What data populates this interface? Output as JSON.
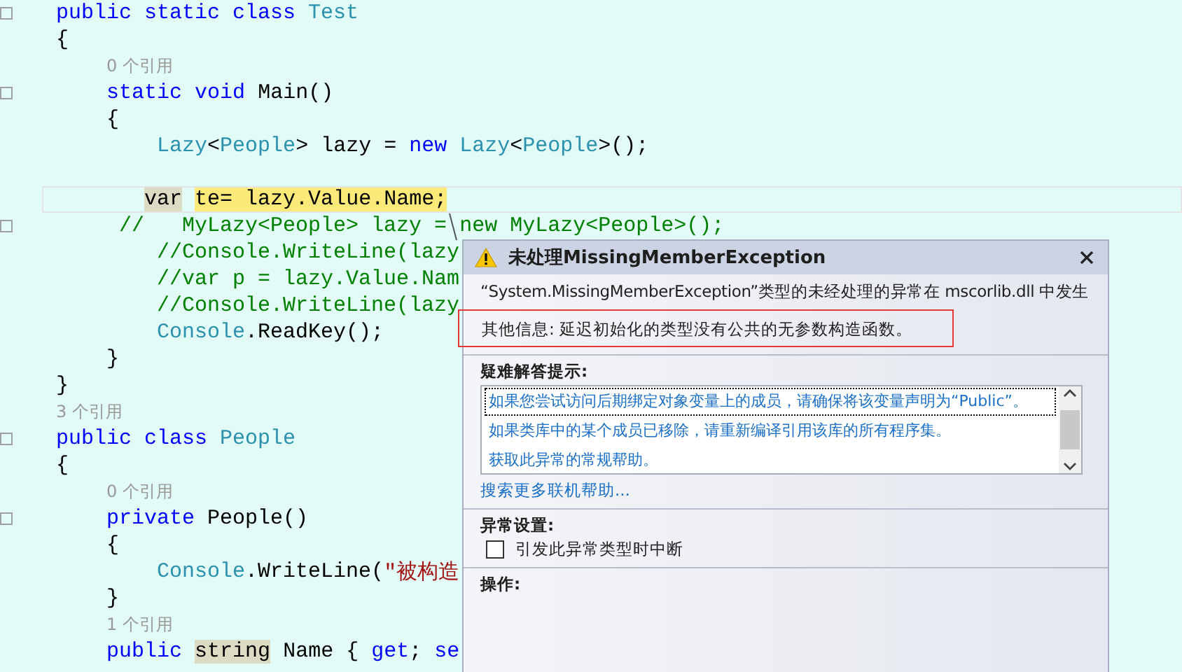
{
  "editor": {
    "lines": [
      {
        "collapsible": true,
        "current": false,
        "tokens": [
          {
            "kind": "keyword",
            "text": "public static class"
          },
          {
            "kind": "type",
            "text": " Test"
          }
        ]
      },
      {
        "collapsible": false,
        "current": false,
        "tokens": [
          {
            "kind": "plain",
            "text": "{"
          }
        ]
      },
      {
        "collapsible": false,
        "current": false,
        "tokens": [
          {
            "kind": "codelens",
            "text": "    0 个引用"
          }
        ]
      },
      {
        "collapsible": true,
        "current": false,
        "tokens": [
          {
            "kind": "keyword",
            "text": "    static void"
          },
          {
            "kind": "plain",
            "text": " Main()"
          }
        ]
      },
      {
        "collapsible": false,
        "current": false,
        "tokens": [
          {
            "kind": "plain",
            "text": "    {"
          }
        ]
      },
      {
        "collapsible": false,
        "current": false,
        "tokens": [
          {
            "kind": "type",
            "text": "        Lazy"
          },
          {
            "kind": "plain",
            "text": "<"
          },
          {
            "kind": "type",
            "text": "People"
          },
          {
            "kind": "plain",
            "text": "> lazy = "
          },
          {
            "kind": "keyword",
            "text": "new"
          },
          {
            "kind": "type",
            "text": " Lazy"
          },
          {
            "kind": "plain",
            "text": "<"
          },
          {
            "kind": "type",
            "text": "People"
          },
          {
            "kind": "plain",
            "text": ">();"
          }
        ]
      },
      {
        "collapsible": false,
        "current": false
      },
      {
        "collapsible": false,
        "current": true,
        "tokens": [
          {
            "kind": "highlight_dim",
            "text": "       var"
          },
          {
            "kind": "highlight",
            "text": " te= lazy.Value.Name;"
          }
        ]
      },
      {
        "collapsible": true,
        "current": false,
        "tokens": [
          {
            "kind": "comment",
            "text": "     //   MyLazy<People> lazy ="
          },
          {
            "kind": "comment",
            "text": " new MyLazy<People>();"
          }
        ]
      },
      {
        "collapsible": false,
        "current": false,
        "tokens": [
          {
            "kind": "comment",
            "text": "        //Console.WriteLine(lazy"
          }
        ]
      },
      {
        "collapsible": false,
        "current": false,
        "tokens": [
          {
            "kind": "comment",
            "text": "        //var p = lazy.Value.Nam"
          }
        ]
      },
      {
        "collapsible": false,
        "current": false,
        "tokens": [
          {
            "kind": "comment",
            "text": "        //Console.WriteLine(lazy"
          }
        ]
      },
      {
        "collapsible": false,
        "current": false,
        "tokens": [
          {
            "kind": "type",
            "text": "        Console"
          },
          {
            "kind": "plain",
            "text": ".ReadKey();"
          }
        ]
      },
      {
        "collapsible": false,
        "current": false,
        "tokens": [
          {
            "kind": "plain",
            "text": "    }"
          }
        ]
      },
      {
        "collapsible": false,
        "current": false,
        "tokens": [
          {
            "kind": "plain",
            "text": "}"
          }
        ]
      },
      {
        "collapsible": false,
        "current": false,
        "tokens": [
          {
            "kind": "codelens",
            "text": "3 个引用"
          }
        ]
      },
      {
        "collapsible": true,
        "current": false,
        "tokens": [
          {
            "kind": "keyword",
            "text": "public class"
          },
          {
            "kind": "type",
            "text": " People"
          }
        ]
      },
      {
        "collapsible": false,
        "current": false,
        "tokens": [
          {
            "kind": "plain",
            "text": "{"
          }
        ]
      },
      {
        "collapsible": false,
        "current": false,
        "tokens": [
          {
            "kind": "codelens",
            "text": "    0 个引用"
          }
        ]
      },
      {
        "collapsible": true,
        "current": false,
        "tokens": [
          {
            "kind": "keyword",
            "text": "    private"
          },
          {
            "kind": "plain",
            "text": " People()"
          }
        ]
      },
      {
        "collapsible": false,
        "current": false,
        "tokens": [
          {
            "kind": "plain",
            "text": "    {"
          }
        ]
      },
      {
        "collapsible": false,
        "current": false,
        "tokens": [
          {
            "kind": "type",
            "text": "        Console"
          },
          {
            "kind": "plain",
            "text": ".WriteLine("
          },
          {
            "kind": "string",
            "text": "\"被构造"
          }
        ]
      },
      {
        "collapsible": false,
        "current": false,
        "tokens": [
          {
            "kind": "plain",
            "text": "    }"
          }
        ]
      },
      {
        "collapsible": false,
        "current": false,
        "tokens": [
          {
            "kind": "codelens",
            "text": "    1 个引用"
          }
        ]
      },
      {
        "collapsible": false,
        "current": false,
        "tokens": [
          {
            "kind": "keyword",
            "text": "    public "
          },
          {
            "kind": "highlight_dim",
            "text": "string"
          },
          {
            "kind": "plain",
            "text": " Name { "
          },
          {
            "kind": "keyword",
            "text": "get"
          },
          {
            "kind": "plain",
            "text": "; "
          },
          {
            "kind": "keyword",
            "text": "se"
          }
        ]
      }
    ]
  },
  "exception_popup": {
    "title": "未处理MissingMemberException",
    "message": "“System.MissingMemberException”类型的未经处理的异常在 mscorlib.dll 中发生",
    "additional_info": "其他信息: 延迟初始化的类型没有公共的无参数构造函数。",
    "troubleshooting": {
      "heading": "疑难解答提示:",
      "tips": [
        {
          "text": "如果您尝试访问后期绑定对象变量上的成员，请确保将该变量声明为“Public”。",
          "selected": true
        },
        {
          "text": "如果类库中的某个成员已移除，请重新编译引用该库的所有程序集。",
          "selected": false
        },
        {
          "text": "获取此异常的常规帮助。",
          "selected": false
        }
      ]
    },
    "more_help_link": "搜索更多联机帮助...",
    "exception_settings": {
      "heading": "异常设置:",
      "break_option": {
        "label": "引发此异常类型时中断",
        "checked": false
      }
    },
    "actions_heading": "操作:"
  }
}
